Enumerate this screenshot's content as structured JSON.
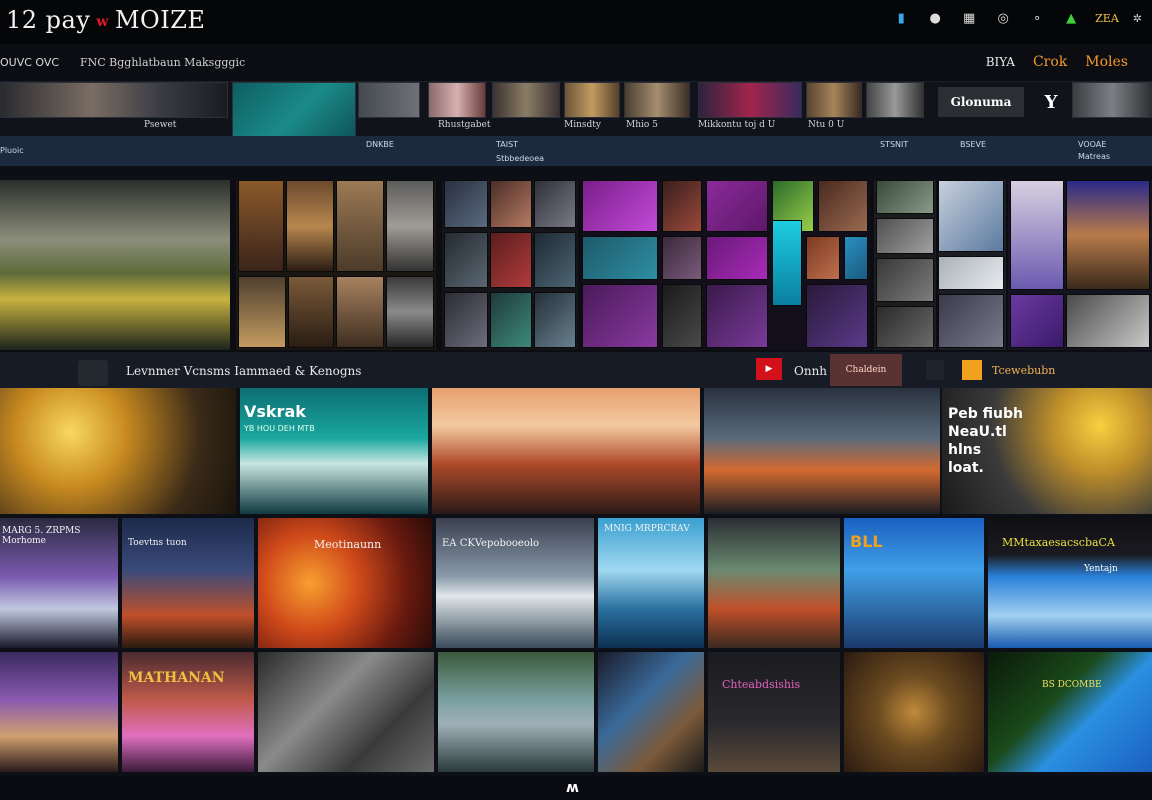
{
  "app": {
    "logo_left": "12 pay",
    "logo_mark": "w",
    "logo_right": "MOIZE"
  },
  "top_icons": [
    {
      "name": "folder-icon",
      "glyph": "▮",
      "color": "#3aa6e8"
    },
    {
      "name": "chat-icon",
      "glyph": "●",
      "color": "#e6e6e6"
    },
    {
      "name": "grid-icon",
      "glyph": "▦",
      "color": "#e6e6e6"
    },
    {
      "name": "globe-icon",
      "glyph": "◎",
      "color": "#e6e6e6"
    },
    {
      "name": "dot-icon",
      "glyph": "∘",
      "color": "#e6e6e6"
    },
    {
      "name": "leaf-icon",
      "glyph": "▲",
      "color": "#3fcf3a"
    }
  ],
  "top_texts": [
    "ZEA",
    "✲"
  ],
  "nav": {
    "left": "OUVC OVC",
    "mid": "FNC Bgghlatbaun Maksgggic",
    "right": [
      "BIYA",
      "Crok",
      "Moles"
    ]
  },
  "strip": {
    "labels": [
      "Psewet",
      "Rhustgabet",
      "Minsdty",
      "Mhio 5",
      "Mikkontu toj d U",
      "Ntu 0 U"
    ],
    "buttons": [
      "Glonuma",
      "Y"
    ]
  },
  "info_row": [
    "Pluoic",
    "DNKBE",
    "TAIST",
    "Stbbedeoea",
    "STSNIT",
    "BSEVE",
    "VOOAE",
    "Matreas"
  ],
  "section": {
    "title": "Levnmer Vcnsms Iammaed & Kenogns",
    "label_a": "Onnh",
    "chip": "Chaldein",
    "label_b": "Tcewebubn"
  },
  "big_tiles": {
    "t1_title": "Vskrak",
    "t1_sub": "YB HOU DEH MTB",
    "t3_lines": [
      "Peb  fiubh",
      "NeaU.tl",
      "hlns",
      "loat."
    ]
  },
  "row2_labels": [
    "MARG 5. ZRPMS Morhome",
    "Toevtns tuon",
    "Meotinaunn",
    "EA CKVepobooeolo",
    "MNIG MRPRCRAV",
    "BLL",
    "MMtaxaesacscbaCA",
    "Yentajn"
  ],
  "row3_labels": [
    "MATHANAN",
    "Chteabdsishis",
    "BS DCOMBE"
  ],
  "colors": {
    "accent_red": "#d3111a",
    "accent_orange": "#f29a2a",
    "accent_green": "#3fcf3a",
    "accent_blue": "#3aa6e8",
    "bg": "#0b0e14"
  }
}
